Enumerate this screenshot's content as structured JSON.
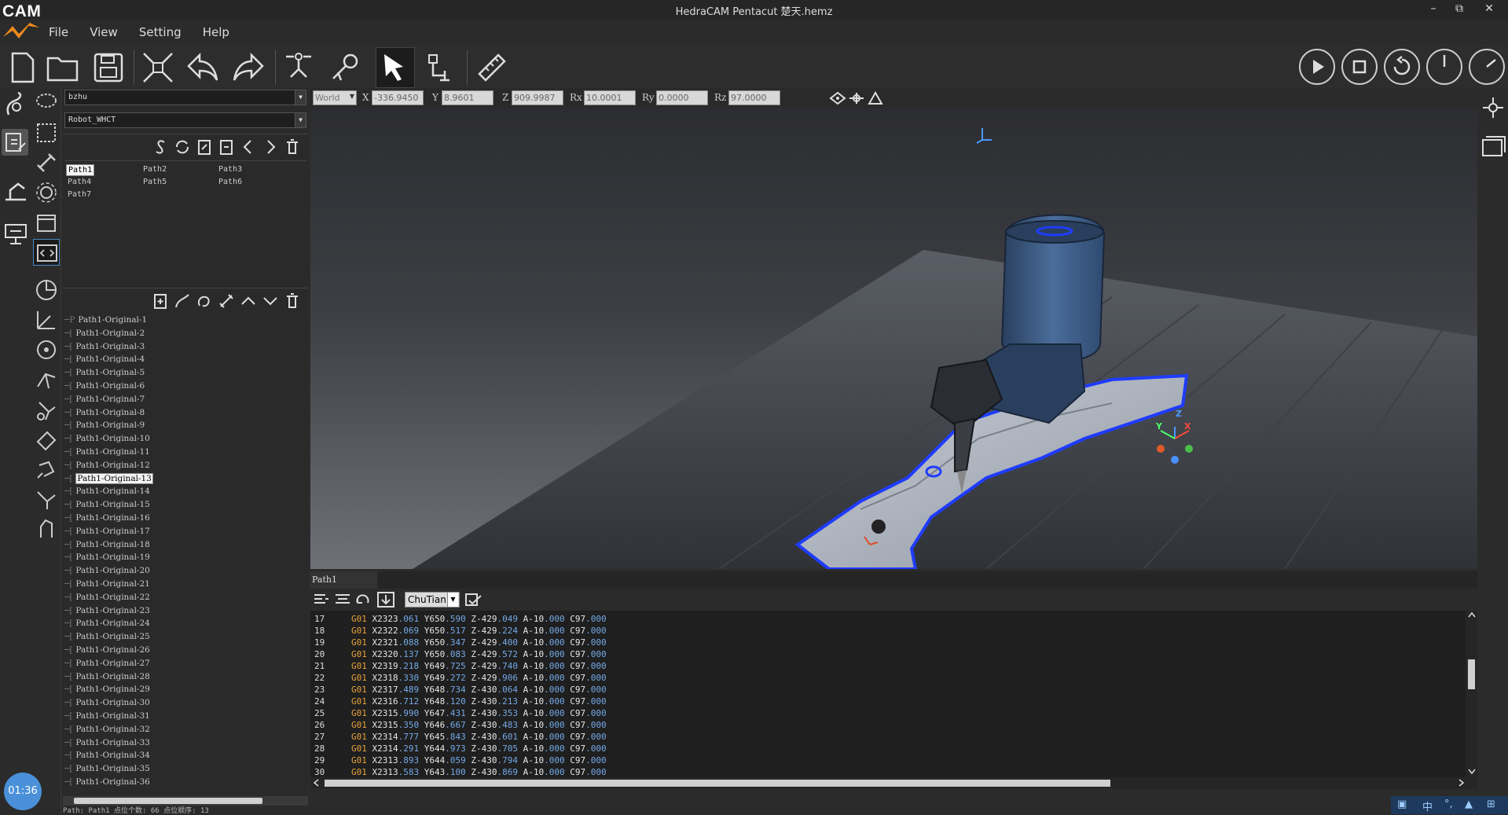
{
  "window": {
    "title": "HedraCAM Pentacut  楚天.hemz",
    "logo_text": "CAM",
    "minimize": "–",
    "maximize": "⧉",
    "close": "✕"
  },
  "menu": {
    "file": "File",
    "view": "View",
    "setting": "Setting",
    "help": "Help"
  },
  "panel": {
    "part_combo": "bzhu",
    "robot_combo": "Robot_WHCT",
    "paths": [
      "Path1",
      "Path2",
      "Path3",
      "Path4",
      "Path5",
      "Path6",
      "Path7"
    ],
    "selected_path": "Path1",
    "tree": [
      "Path1-Original-1",
      "Path1-Original-2",
      "Path1-Original-3",
      "Path1-Original-4",
      "Path1-Original-5",
      "Path1-Original-6",
      "Path1-Original-7",
      "Path1-Original-8",
      "Path1-Original-9",
      "Path1-Original-10",
      "Path1-Original-11",
      "Path1-Original-12",
      "Path1-Original-13",
      "Path1-Original-14",
      "Path1-Original-15",
      "Path1-Original-16",
      "Path1-Original-17",
      "Path1-Original-18",
      "Path1-Original-19",
      "Path1-Original-20",
      "Path1-Original-21",
      "Path1-Original-22",
      "Path1-Original-23",
      "Path1-Original-24",
      "Path1-Original-25",
      "Path1-Original-26",
      "Path1-Original-27",
      "Path1-Original-28",
      "Path1-Original-29",
      "Path1-Original-30",
      "Path1-Original-31",
      "Path1-Original-32",
      "Path1-Original-33",
      "Path1-Original-34",
      "Path1-Original-35",
      "Path1-Original-36"
    ],
    "selected_tree_item": "Path1-Original-13",
    "status": "Path: Path1  点位个数: 66  点位顺序: 13"
  },
  "coords": {
    "frame": "World",
    "x_label": "X",
    "x": "-336.9450",
    "y_label": "Y",
    "y": "8.9601",
    "z_label": "Z",
    "z": "909.9987",
    "rx_label": "Rx",
    "rx": "10.0001",
    "ry_label": "Ry",
    "ry": "0.0000",
    "rz_label": "Rz",
    "rz": "97.0000"
  },
  "viewport": {
    "axis_x": "X",
    "axis_y": "Y",
    "axis_z": "Z"
  },
  "code": {
    "tab": "Path1",
    "post": "ChuTian",
    "lines": [
      {
        "n": "17",
        "g": "G01",
        "x": "X2323",
        "xd": ".061",
        "y": "Y650",
        "yd": ".590",
        "z": "Z-429",
        "zd": ".049",
        "a": "A-10",
        "ad": ".000",
        "c": "C97",
        "cd": ".000"
      },
      {
        "n": "18",
        "g": "G01",
        "x": "X2322",
        "xd": ".069",
        "y": "Y650",
        "yd": ".517",
        "z": "Z-429",
        "zd": ".224",
        "a": "A-10",
        "ad": ".000",
        "c": "C97",
        "cd": ".000"
      },
      {
        "n": "19",
        "g": "G01",
        "x": "X2321",
        "xd": ".088",
        "y": "Y650",
        "yd": ".347",
        "z": "Z-429",
        "zd": ".400",
        "a": "A-10",
        "ad": ".000",
        "c": "C97",
        "cd": ".000"
      },
      {
        "n": "20",
        "g": "G01",
        "x": "X2320",
        "xd": ".137",
        "y": "Y650",
        "yd": ".083",
        "z": "Z-429",
        "zd": ".572",
        "a": "A-10",
        "ad": ".000",
        "c": "C97",
        "cd": ".000"
      },
      {
        "n": "21",
        "g": "G01",
        "x": "X2319",
        "xd": ".218",
        "y": "Y649",
        "yd": ".725",
        "z": "Z-429",
        "zd": ".740",
        "a": "A-10",
        "ad": ".000",
        "c": "C97",
        "cd": ".000"
      },
      {
        "n": "22",
        "g": "G01",
        "x": "X2318",
        "xd": ".330",
        "y": "Y649",
        "yd": ".272",
        "z": "Z-429",
        "zd": ".906",
        "a": "A-10",
        "ad": ".000",
        "c": "C97",
        "cd": ".000"
      },
      {
        "n": "23",
        "g": "G01",
        "x": "X2317",
        "xd": ".489",
        "y": "Y648",
        "yd": ".734",
        "z": "Z-430",
        "zd": ".064",
        "a": "A-10",
        "ad": ".000",
        "c": "C97",
        "cd": ".000"
      },
      {
        "n": "24",
        "g": "G01",
        "x": "X2316",
        "xd": ".712",
        "y": "Y648",
        "yd": ".120",
        "z": "Z-430",
        "zd": ".213",
        "a": "A-10",
        "ad": ".000",
        "c": "C97",
        "cd": ".000"
      },
      {
        "n": "25",
        "g": "G01",
        "x": "X2315",
        "xd": ".990",
        "y": "Y647",
        "yd": ".431",
        "z": "Z-430",
        "zd": ".353",
        "a": "A-10",
        "ad": ".000",
        "c": "C97",
        "cd": ".000"
      },
      {
        "n": "26",
        "g": "G01",
        "x": "X2315",
        "xd": ".350",
        "y": "Y646",
        "yd": ".667",
        "z": "Z-430",
        "zd": ".483",
        "a": "A-10",
        "ad": ".000",
        "c": "C97",
        "cd": ".000"
      },
      {
        "n": "27",
        "g": "G01",
        "x": "X2314",
        "xd": ".777",
        "y": "Y645",
        "yd": ".843",
        "z": "Z-430",
        "zd": ".601",
        "a": "A-10",
        "ad": ".000",
        "c": "C97",
        "cd": ".000"
      },
      {
        "n": "28",
        "g": "G01",
        "x": "X2314",
        "xd": ".291",
        "y": "Y644",
        "yd": ".973",
        "z": "Z-430",
        "zd": ".705",
        "a": "A-10",
        "ad": ".000",
        "c": "C97",
        "cd": ".000"
      },
      {
        "n": "29",
        "g": "G01",
        "x": "X2313",
        "xd": ".893",
        "y": "Y644",
        "yd": ".059",
        "z": "Z-430",
        "zd": ".794",
        "a": "A-10",
        "ad": ".000",
        "c": "C97",
        "cd": ".000"
      },
      {
        "n": "30",
        "g": "G01",
        "x": "X2313",
        "xd": ".583",
        "y": "Y643",
        "yd": ".100",
        "z": "Z-430",
        "zd": ".869",
        "a": "A-10",
        "ad": ".000",
        "c": "C97",
        "cd": ".000"
      }
    ]
  },
  "taskbar": {
    "clock": "01:36",
    "ime": "中"
  },
  "colors": {
    "gcode": "#e8a23c",
    "decimal": "#74a9e6",
    "path_highlight": "#1f3cff"
  }
}
